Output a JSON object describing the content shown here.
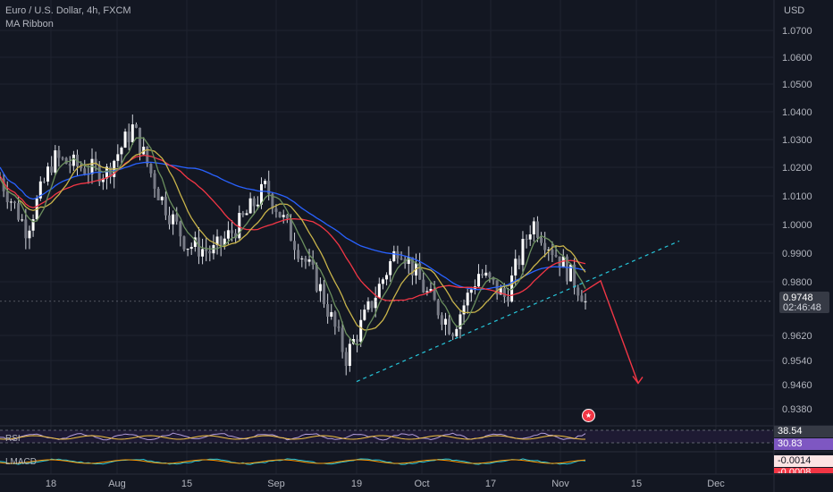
{
  "header": {
    "symbol_title": "Euro / U.S. Dollar, 4h, FXCM",
    "indicator": "MA Ribbon"
  },
  "axis": {
    "currency": "USD",
    "price_ticks": [
      "1.0700",
      "1.0600",
      "1.0500",
      "1.0400",
      "1.0300",
      "1.0200",
      "1.0100",
      "1.0000",
      "0.9900",
      "0.9800",
      "0.9620",
      "0.9540",
      "0.9460",
      "0.9380"
    ],
    "time_ticks": [
      "18",
      "Aug",
      "15",
      "Sep",
      "19",
      "Oct",
      "17",
      "Nov",
      "15",
      "Dec"
    ]
  },
  "price_badge": {
    "value": "0.9748",
    "countdown": "02:46:48"
  },
  "rsi": {
    "label": "RSI",
    "value_a": "38.54",
    "value_b": "30.83"
  },
  "macd": {
    "label": "LMACD",
    "value_a": "-0.0014",
    "value_b": "-0.0008"
  },
  "colors": {
    "background": "#131722",
    "candle": "#d1d4dc",
    "ma_blue": "#2962ff",
    "ma_red": "#f23645",
    "ma_yellow": "#c9b44a",
    "ma_green": "#6b8f5e",
    "trendline": "#26c6da",
    "arrow": "#f23645",
    "rsi_badge": "#7e57c2"
  },
  "chart_data": {
    "type": "line",
    "title": "Euro / U.S. Dollar, 4h, FXCM",
    "ylabel": "USD",
    "ylim": [
      0.936,
      1.074
    ],
    "x": [
      "18",
      "Aug",
      "15",
      "Sep",
      "19",
      "Oct",
      "17",
      "Nov",
      "15",
      "Dec"
    ],
    "series": [
      {
        "name": "",
        "values": [
          1.018,
          1.0,
          1.025,
          1.022,
          1.02,
          1.036,
          1.012,
          0.995,
          0.992,
          1.002,
          1.015,
          0.997,
          0.98,
          0.955,
          0.975,
          0.995,
          0.978,
          0.965,
          0.985,
          0.976,
          1.003,
          0.99,
          0.976
        ]
      }
    ],
    "trendline": {
      "from": [
        "19",
        0.9466
      ],
      "to": [
        "15",
        0.996
      ]
    },
    "projection": [
      0.982,
      0.946
    ],
    "last_price": 0.9748
  }
}
